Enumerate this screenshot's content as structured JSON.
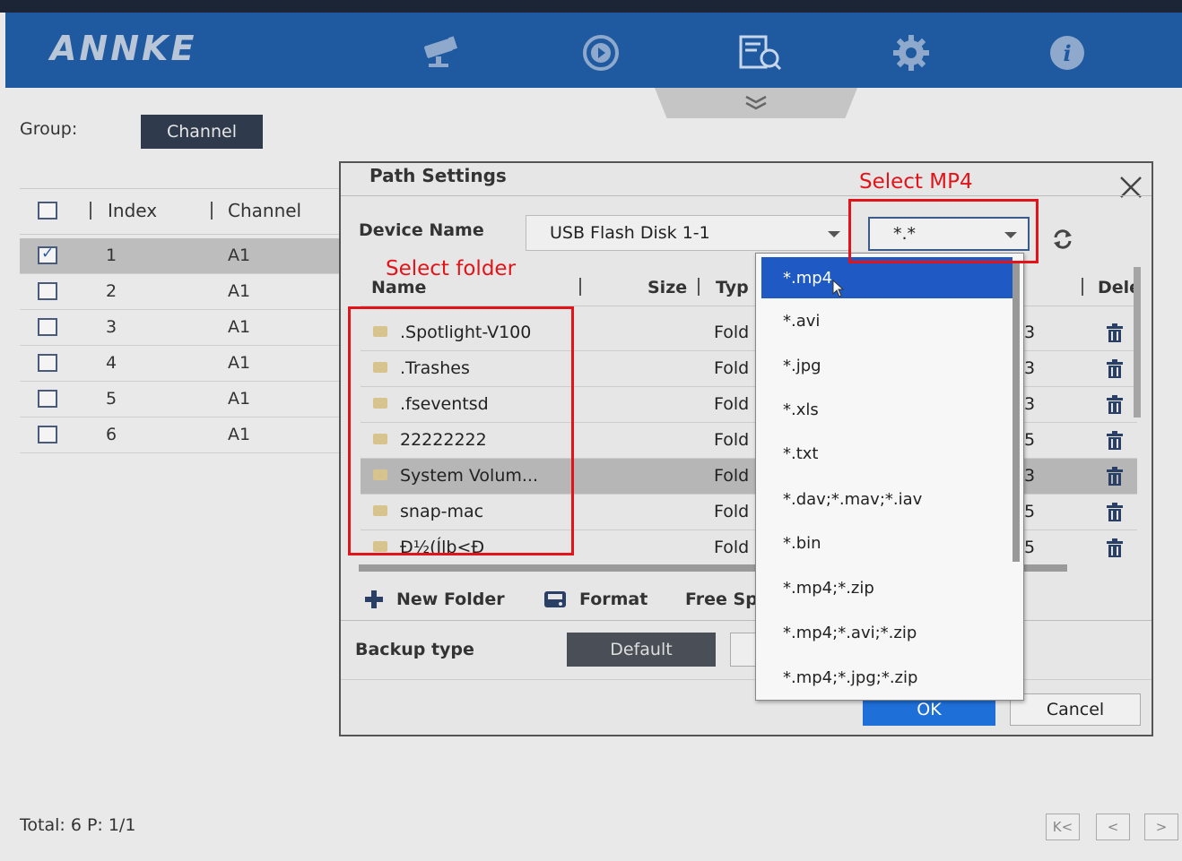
{
  "header": {
    "logo": "ANNKE",
    "nav_icons": [
      "camera-icon",
      "playback-icon",
      "search-files-icon",
      "gear-icon",
      "info-icon"
    ],
    "accent_color": "#1f5aa0"
  },
  "left_panel": {
    "group_label": "Group:",
    "group_button": "Channel",
    "columns": [
      "Index",
      "Channel"
    ],
    "rows": [
      {
        "index": "1",
        "channel": "A1",
        "checked": true
      },
      {
        "index": "2",
        "channel": "A1",
        "checked": false
      },
      {
        "index": "3",
        "channel": "A1",
        "checked": false
      },
      {
        "index": "4",
        "channel": "A1",
        "checked": false
      },
      {
        "index": "5",
        "channel": "A1",
        "checked": false
      },
      {
        "index": "6",
        "channel": "A1",
        "checked": false
      }
    ],
    "footer": "Total: 6 P: 1/1"
  },
  "dialog": {
    "title": "Path Settings",
    "device_label": "Device Name",
    "device_value": "USB Flash Disk 1-1",
    "file_type_value": "*.*",
    "columns": {
      "name": "Name",
      "size": "Size",
      "type": "Typ",
      "delete": "Dele"
    },
    "files": [
      {
        "name": ".Spotlight-V100",
        "type": "Fold",
        "size_tail": "3"
      },
      {
        "name": ".Trashes",
        "type": "Fold",
        "size_tail": "3"
      },
      {
        "name": ".fseventsd",
        "type": "Fold",
        "size_tail": "3"
      },
      {
        "name": "22222222",
        "type": "Fold",
        "size_tail": "5"
      },
      {
        "name": "System Volum...",
        "type": "Fold",
        "size_tail": "3"
      },
      {
        "name": "snap-mac",
        "type": "Fold",
        "size_tail": "5"
      },
      {
        "name": "Ð½(Ílb<Ð",
        "type": "Fold",
        "size_tail": "5"
      }
    ],
    "toolbar": {
      "new_folder": "New Folder",
      "format": "Format",
      "free_space": "Free Sp"
    },
    "backup_label": "Backup type",
    "backup_value": "Default",
    "ok": "OK",
    "cancel": "Cancel"
  },
  "dropdown": {
    "options": [
      "*.mp4",
      "*.avi",
      "*.jpg",
      "*.xls",
      "*.txt",
      "*.dav;*.mav;*.iav",
      "*.bin",
      "*.mp4;*.zip",
      "*.mp4;*.avi;*.zip",
      "*.mp4;*.jpg;*.zip"
    ],
    "highlighted": "*.mp4"
  },
  "annotations": {
    "select_mp4": "Select MP4",
    "select_folder": "Select folder",
    "color": "#e2141a"
  },
  "pager": [
    "K<",
    "<",
    ">"
  ]
}
